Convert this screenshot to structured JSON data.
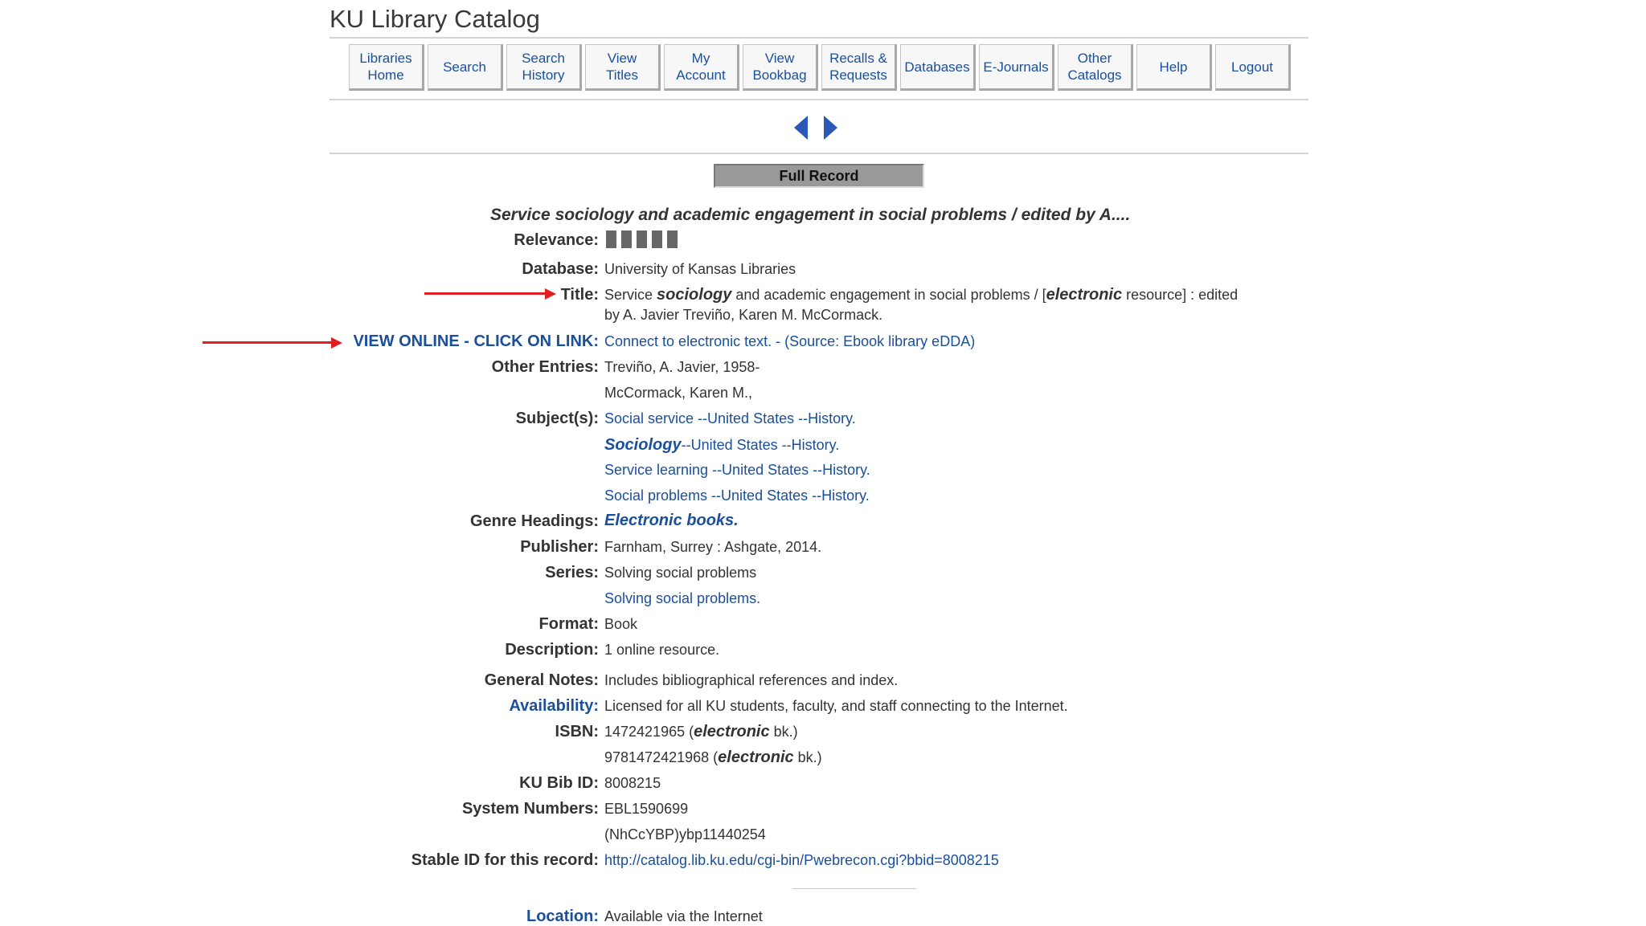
{
  "header": {
    "title": "KU Library Catalog"
  },
  "nav": [
    {
      "label": "Libraries\nHome"
    },
    {
      "label": "Search"
    },
    {
      "label": "Search\nHistory"
    },
    {
      "label": "View\nTitles"
    },
    {
      "label": "My\nAccount"
    },
    {
      "label": "View\nBookbag"
    },
    {
      "label": "Recalls &\nRequests"
    },
    {
      "label": "Databases"
    },
    {
      "label": "E-Journals"
    },
    {
      "label": "Other\nCatalogs"
    },
    {
      "label": "Help"
    },
    {
      "label": "Logout"
    }
  ],
  "record": {
    "section_label": "Full Record",
    "display_title": "Service sociology and academic engagement in social problems / edited by A....",
    "relevance_label": "Relevance:",
    "relevance_level": 5,
    "fields": {
      "database": {
        "label": "Database:",
        "value": "University of Kansas Libraries"
      },
      "title": {
        "label": "Title:",
        "value_parts": [
          "Service ",
          "sociology",
          " and academic engagement in social problems / [",
          "electronic",
          " resource] : edited"
        ],
        "value_line2": "by A. Javier Treviño, Karen M. McCormack."
      },
      "view_online": {
        "label": "VIEW ONLINE - CLICK ON LINK:",
        "value": "Connect to electronic text. - (Source: Ebook library eDDA)"
      },
      "other_entries": {
        "label": "Other Entries:",
        "values": [
          "Treviño, A. Javier, 1958-",
          "McCormack, Karen M.,"
        ]
      },
      "subjects": {
        "label": "Subject(s):",
        "values": [
          "Social service --United States --History.",
          "--United States --History.",
          "Service learning --United States --History.",
          "Social problems --United States --History."
        ],
        "emph": "Sociology"
      },
      "genre": {
        "label": "Genre Headings:",
        "value": "Electronic books."
      },
      "publisher": {
        "label": "Publisher:",
        "value": "Farnham, Surrey : Ashgate, 2014."
      },
      "series": {
        "label": "Series:",
        "values": [
          "Solving social problems",
          "Solving social problems."
        ]
      },
      "format": {
        "label": "Format:",
        "value": "Book"
      },
      "description": {
        "label": "Description:",
        "value": "1 online resource."
      },
      "general_notes": {
        "label": "General Notes:",
        "value": "Includes bibliographical references and index."
      },
      "availability": {
        "label": "Availability:",
        "value": "Licensed for all KU students, faculty, and staff connecting to the Internet."
      },
      "isbn": {
        "label": "ISBN:",
        "values": [
          "1472421965 (",
          "9781472421968 ("
        ],
        "emph": "electronic",
        "suffix": " bk.)"
      },
      "bib_id": {
        "label": "KU Bib ID:",
        "value": "8008215"
      },
      "system_numbers": {
        "label": "System Numbers:",
        "values": [
          "EBL1590699",
          "(NhCcYBP)ybp11440254"
        ]
      },
      "stable_id": {
        "label": "Stable ID for this record:",
        "value": "http://catalog.lib.ku.edu/cgi-bin/Pwebrecon.cgi?bbid=8008215"
      },
      "location": {
        "label": "Location:",
        "value": "Available via the Internet"
      }
    }
  },
  "colors": {
    "link": "#1a4f9c",
    "annotation_arrow": "#e02020"
  }
}
